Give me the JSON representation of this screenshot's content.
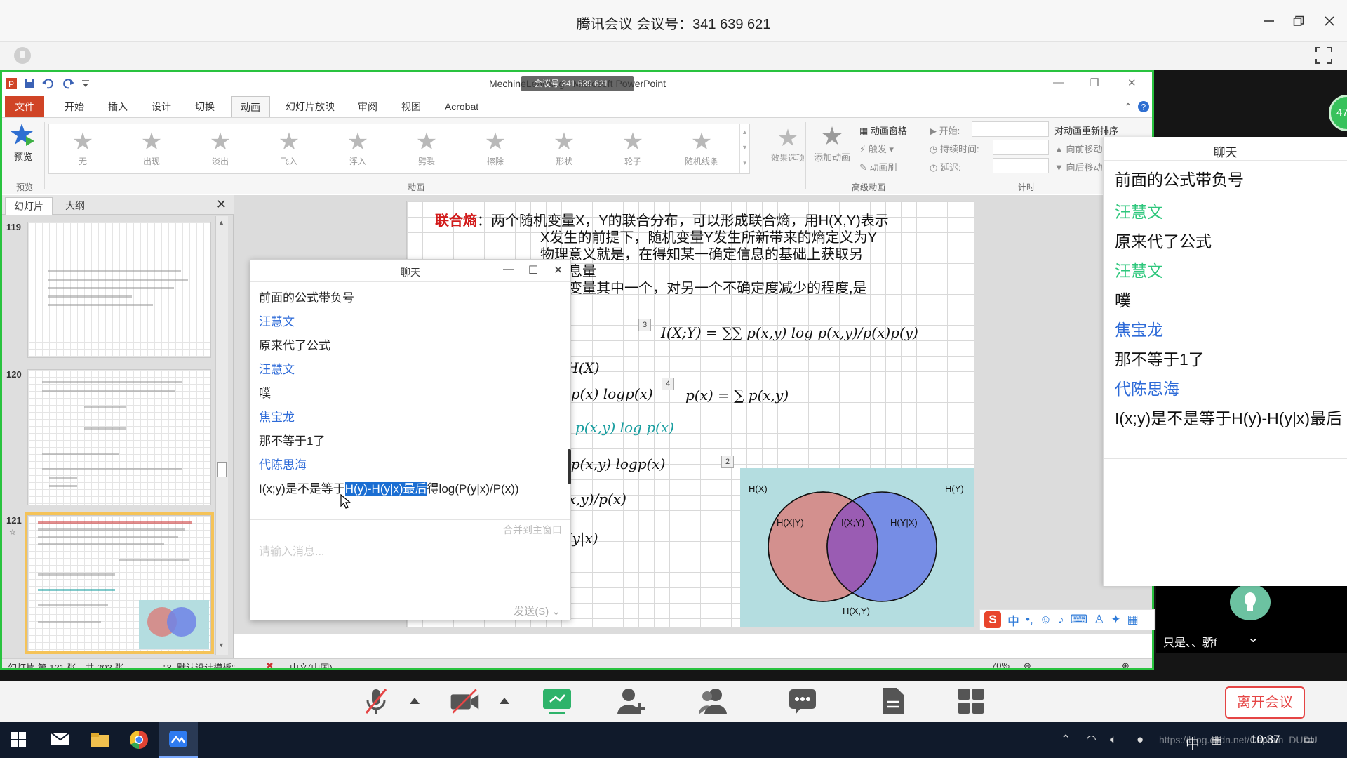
{
  "meeting": {
    "title": "腾讯会议 会议号：341 639 621",
    "leave_label": "离开会议"
  },
  "ppt": {
    "window_title": "MechineLearning - Microsoft PowerPoint",
    "badge": "会议号 341 639 621",
    "tabs": [
      "文件",
      "开始",
      "插入",
      "设计",
      "切换",
      "动画",
      "幻灯片放映",
      "审阅",
      "视图",
      "Acrobat"
    ],
    "active_tab": "动画",
    "preview_label": "预览",
    "preview_group": "预览",
    "animations": [
      "无",
      "出现",
      "淡出",
      "飞入",
      "浮入",
      "劈裂",
      "擦除",
      "形状",
      "轮子",
      "随机线条"
    ],
    "effect_options": "效果选项",
    "animation_group": "动画",
    "add_animation": "添加动画",
    "anim_pane": "动画窗格",
    "trigger": "触发",
    "anim_painter": "动画刷",
    "advanced_group": "高级动画",
    "start_label": "开始:",
    "duration_label": "持续时间:",
    "delay_label": "延迟:",
    "timing_group": "计时",
    "reorder_label": "对动画重新排序",
    "move_earlier": "向前移动",
    "move_later": "向后移动",
    "panel_tabs": [
      "幻灯片",
      "大纲"
    ],
    "slide_numbers": [
      "119",
      "120",
      "121"
    ],
    "status_slide": "幻灯片 第 121 张，共 202 张",
    "status_theme": "\"3_默认设计模板\"",
    "status_lang": "中文(中国)",
    "zoom": "70%"
  },
  "slide": {
    "lines": [
      {
        "bold": "联合熵",
        "text": "：两个随机变量X，Y的联合分布，可以形成联合熵，用H(X,Y)表示"
      },
      {
        "bold": "",
        "text": "X发生的前提下，随机变量Y发生所新带来的熵定义为Y"
      },
      {
        "bold": "",
        "text": "物理意义就是，在得知某一确定信息的基础上获取另"
      },
      {
        "bold": "",
        "text": "的信息量"
      },
      {
        "bold": "",
        "text": "两个变量其中一个，对另一个不确定度减少的程度,是"
      },
      {
        "bold": "",
        "text": "量度"
      }
    ],
    "formula_mi": "I(X;Y) = ∑∑ p(x,y) log p(x,y)/p(x)p(y)",
    "formula_px": "p(x) = ∑ p(x,y)",
    "partial_formulas": [
      ") − H(X)",
      "+ ∑ p(x) logp(x)",
      "∑∑ p(x,y) log p(x)",
      "+ ∑ p(x,y) logp(x)",
      "g p(x,y)/p(x)",
      "ogp(y|x)"
    ],
    "anim_badges": [
      "3",
      "4",
      "2"
    ],
    "venn": {
      "hx": "H(X)",
      "hy": "H(Y)",
      "hxgy": "H(X|Y)",
      "ixy": "I(X;Y)",
      "hygx": "H(Y|X)",
      "hxy": "H(X,Y)",
      "left_color": "#d3908e",
      "right_color": "#6f84e6",
      "overlap_color": "#9a5cb3"
    }
  },
  "float_chat": {
    "title": "聊天",
    "messages": [
      {
        "type": "text",
        "value": "前面的公式带负号"
      },
      {
        "type": "name",
        "value": "汪慧文"
      },
      {
        "type": "text",
        "value": "原来代了公式"
      },
      {
        "type": "name",
        "value": "汪慧文"
      },
      {
        "type": "text",
        "value": "噗"
      },
      {
        "type": "name",
        "value": "焦宝龙"
      },
      {
        "type": "text",
        "value": "那不等于1了"
      },
      {
        "type": "name",
        "value": "代陈思海"
      }
    ],
    "last_pre": "I(x;y)是不是等于",
    "last_highlight": "H(y)-H(y|x)最后",
    "last_post": "得log(P(y|x)/P(x))",
    "merge_label": "合并到主窗口",
    "input_placeholder": "请输入消息...",
    "send_label": "发送(S)"
  },
  "side_chat": {
    "title": "聊天",
    "messages": [
      {
        "type": "text",
        "value": "前面的公式带负号"
      },
      {
        "type": "green",
        "value": "汪慧文"
      },
      {
        "type": "text",
        "value": "原来代了公式"
      },
      {
        "type": "green",
        "value": "汪慧文"
      },
      {
        "type": "text",
        "value": "噗"
      },
      {
        "type": "blue",
        "value": "焦宝龙"
      },
      {
        "type": "text",
        "value": "那不等于1了"
      },
      {
        "type": "blue",
        "value": "代陈思海"
      },
      {
        "type": "text",
        "value": "I(x;y)是不是等于H(y)-H(y|x)最后"
      }
    ]
  },
  "participant_badge": "47",
  "video_caption": "只是、、骄f",
  "ime": {
    "lang": "中",
    "punct": "•,"
  },
  "taskbar": {
    "ime": "中",
    "time": "10:37",
    "url": "https://blog.csdn.net/Captain_DUDU"
  },
  "colors": {
    "share_border": "#29c33f",
    "ppt_file_tab": "#d04426",
    "leave": "#e54545",
    "highlight": "#1b6ed2"
  }
}
